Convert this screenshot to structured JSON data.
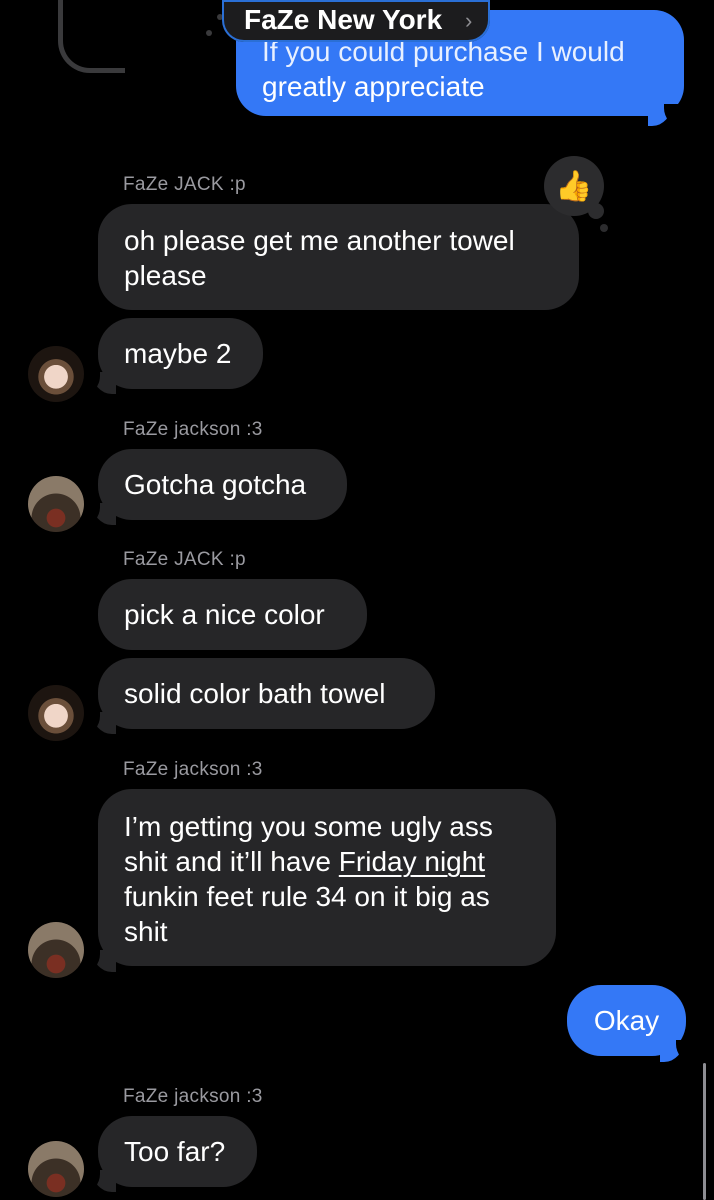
{
  "header": {
    "contact_name": "FaZe New York",
    "chevron": "›"
  },
  "messages": {
    "m0": {
      "text_line1": "If you could purchase I would",
      "text_line2": "greatly appreciate"
    },
    "s1": "FaZe JACK :p",
    "m1": {
      "line1": "oh please get me another towel",
      "line2": "please",
      "reaction_icon": "thumbs-up-icon",
      "reaction": "👍"
    },
    "m2": "maybe 2",
    "s2": "FaZe jackson :3",
    "m3": "Gotcha gotcha",
    "s3": "FaZe JACK :p",
    "m4": "pick a nice color",
    "m5": "solid color bath towel",
    "s4": "FaZe jackson :3",
    "m6": {
      "line1": "I’m getting you some ugly ass",
      "line2_a": "shit and it’ll have ",
      "line2_link": "Friday night",
      "line3": "funkin feet rule 34 on it big as",
      "line4": "shit"
    },
    "m7": "Okay",
    "s5": "FaZe jackson :3",
    "m8": "Too far?"
  },
  "colors": {
    "background": "#000000",
    "received_bubble": "#262628",
    "sent_bubble": "#3478f6",
    "sender_label": "#9a9aa0"
  }
}
